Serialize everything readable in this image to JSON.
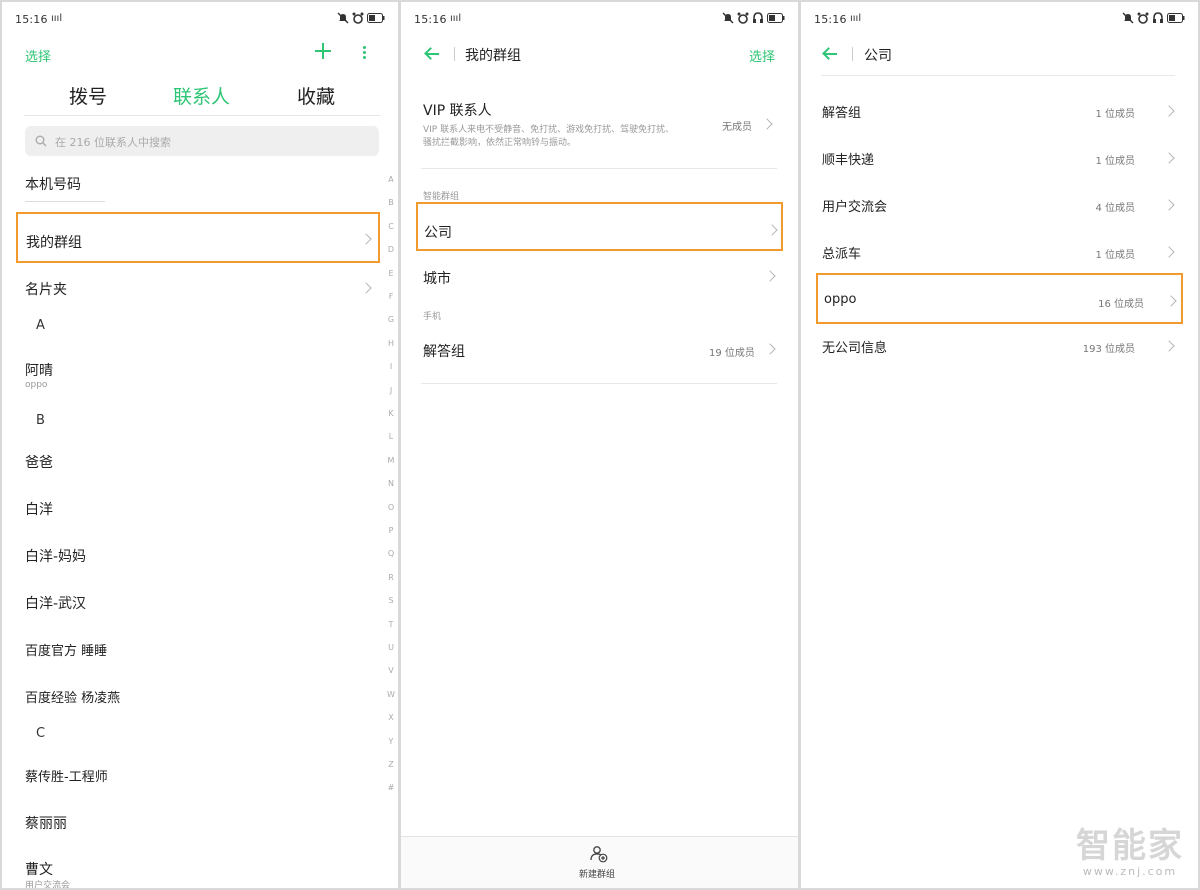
{
  "status_bar": {
    "time": "15:16",
    "signal": "ıııl"
  },
  "panel1": {
    "select_label": "选择",
    "tabs": [
      "拨号",
      "联系人",
      "收藏"
    ],
    "search_placeholder": "在 216 位联系人中搜索",
    "rows": {
      "my_number": "本机号码",
      "my_groups": "我的群组",
      "cards": "名片夹",
      "letter_a": "A",
      "aqing": "阿晴",
      "aqing_sub": "oppo",
      "letter_b": "B",
      "baba": "爸爸",
      "baiyang": "白洋",
      "baiyang_mama": "白洋-妈妈",
      "baiyang_wuhan": "白洋-武汉",
      "baidu_official": "百度官方 睡睡",
      "baidu_exp": "百度经验 杨凌燕",
      "letter_c": "C",
      "cai_engineer": "蔡传胜-工程师",
      "cai_li": "蔡丽丽",
      "cao_wen": "曹文",
      "cao_wen_sub": "用户交流会"
    },
    "alphabet": [
      "A",
      "B",
      "C",
      "D",
      "E",
      "F",
      "G",
      "H",
      "I",
      "J",
      "K",
      "L",
      "M",
      "N",
      "O",
      "P",
      "Q",
      "R",
      "S",
      "T",
      "U",
      "V",
      "W",
      "X",
      "Y",
      "Z",
      "#"
    ]
  },
  "panel2": {
    "title": "我的群组",
    "select_label": "选择",
    "vip_title": "VIP 联系人",
    "vip_desc_1": "VIP 联系人来电不受静音、免打扰、游戏免打扰、驾驶免打扰、",
    "vip_desc_2": "骚扰拦截影响，依然正常响铃与振动。",
    "vip_count": "无成员",
    "smart_group_label": "智能群组",
    "company": "公司",
    "city": "城市",
    "phone_label": "手机",
    "answer_group": "解答组",
    "answer_count": "19 位成员",
    "new_group": "新建群组"
  },
  "panel3": {
    "title": "公司",
    "rows": [
      {
        "name": "解答组",
        "count": "1 位成员"
      },
      {
        "name": "顺丰快递",
        "count": "1 位成员"
      },
      {
        "name": "用户交流会",
        "count": "4 位成员"
      },
      {
        "name": "总派车",
        "count": "1 位成员"
      },
      {
        "name": "oppo",
        "count": "16 位成员"
      },
      {
        "name": "无公司信息",
        "count": "193 位成员"
      }
    ]
  },
  "watermark": {
    "line1": "智能家",
    "line2": "www.znj.com"
  },
  "colors": {
    "accent": "#2ec574",
    "highlight": "#f29a2e"
  }
}
